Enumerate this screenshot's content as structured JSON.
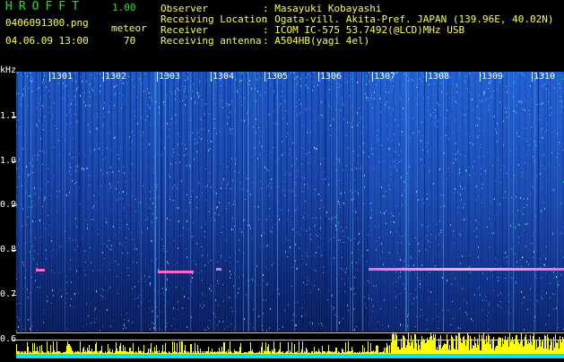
{
  "app": {
    "name": "HROFFT",
    "version": "1.00"
  },
  "file": {
    "name": "0406091300.png",
    "datetime": "04.06.09 13:00"
  },
  "count": {
    "label": "meteor",
    "value": "70"
  },
  "info": {
    "observer_label": "Observer",
    "observer_value": ": Masayuki Kobayashi",
    "location_label": "Receiving Location",
    "location_value": ": Ogata-vill. Akita-Pref. JAPAN (139.96E, 40.02N)",
    "receiver_label": "Receiver",
    "receiver_value": ": ICOM IC-575 53.7492(@LCD)MHz USB",
    "antenna_label": "Receiving antenna",
    "antenna_value": ": A504HB(yagi 4el)"
  },
  "axis": {
    "unit": "kHz",
    "labels": [
      "1.1",
      "1.0",
      "0.9",
      "0.8",
      "0.7",
      "0.6"
    ]
  },
  "minutes": [
    "1301",
    "1302",
    "1303",
    "1304",
    "1305",
    "1306",
    "1307",
    "1308",
    "1309",
    "1310"
  ],
  "colors": {
    "title": "#19e619",
    "meta": "#ffff33",
    "spectrum": "#1a4cb8",
    "meteor": "#ff66cc",
    "bars": "#ffff00",
    "baseline": "#00e5ff"
  }
}
